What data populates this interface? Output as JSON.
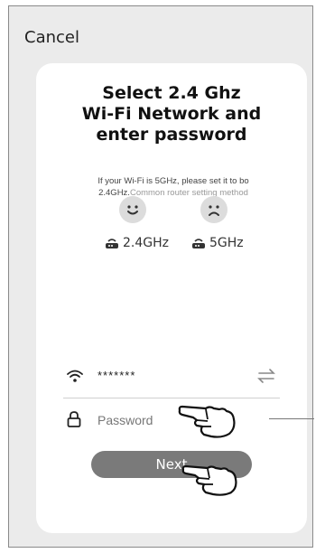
{
  "header": {
    "cancel_label": "Cancel"
  },
  "card": {
    "title": "Select 2.4 Ghz\nWi-Fi Network and\nenter password",
    "info_main": "If your Wi-Fi is 5GHz, please set it to bo 2.4GHz.",
    "info_link": "Common router setting method",
    "faces": [
      {
        "icon": "smile-face-icon",
        "freq_label": "2.4GHz"
      },
      {
        "icon": "sad-face-icon",
        "freq_label": "5GHz"
      }
    ]
  },
  "form": {
    "wifi_name": "*******",
    "password_placeholder": "Password",
    "next_label": "Next"
  },
  "colors": {
    "background": "#ebebeb",
    "card": "#ffffff",
    "button": "#7a7a7a",
    "face": "#dcdcdc"
  }
}
